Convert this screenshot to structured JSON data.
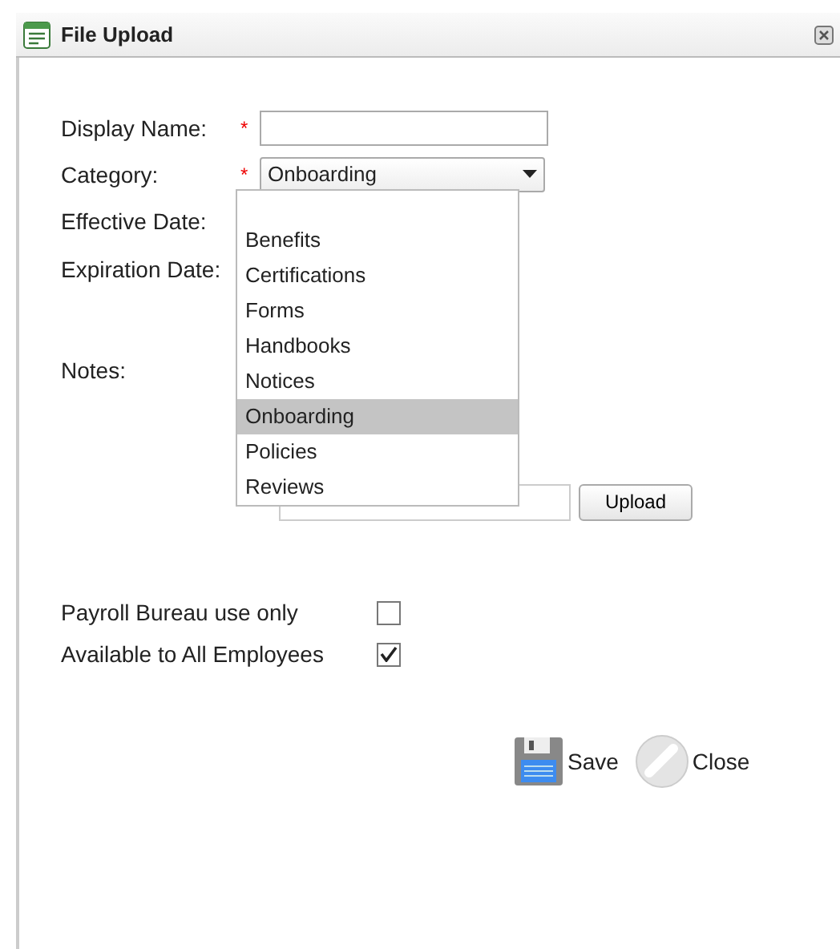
{
  "window": {
    "title": "File Upload"
  },
  "fields": [
    {
      "kind": "text",
      "label": "Display Name:",
      "required_mark": "*"
    },
    {
      "kind": "select",
      "label": "Category:",
      "required_mark": "*",
      "value": "Onboarding"
    },
    {
      "kind": "date",
      "label": "Effective Date:"
    },
    {
      "kind": "date",
      "label": "Expiration Date:"
    },
    {
      "kind": "notes",
      "label": "Notes:"
    }
  ],
  "category_options": [
    {
      "label": "Benefits",
      "selected": false
    },
    {
      "label": "Certifications",
      "selected": false
    },
    {
      "label": "Forms",
      "selected": false
    },
    {
      "label": "Handbooks",
      "selected": false
    },
    {
      "label": "Notices",
      "selected": false
    },
    {
      "label": "Onboarding",
      "selected": true
    },
    {
      "label": "Policies",
      "selected": false
    },
    {
      "label": "Reviews",
      "selected": false
    }
  ],
  "upload_button": "Upload",
  "checkboxes": [
    {
      "label": "Payroll Bureau use only",
      "checked": false
    },
    {
      "label": "Available to All Employees",
      "checked": true
    }
  ],
  "actions": [
    {
      "kind": "save",
      "label": "Save"
    },
    {
      "kind": "close",
      "label": "Close"
    }
  ]
}
